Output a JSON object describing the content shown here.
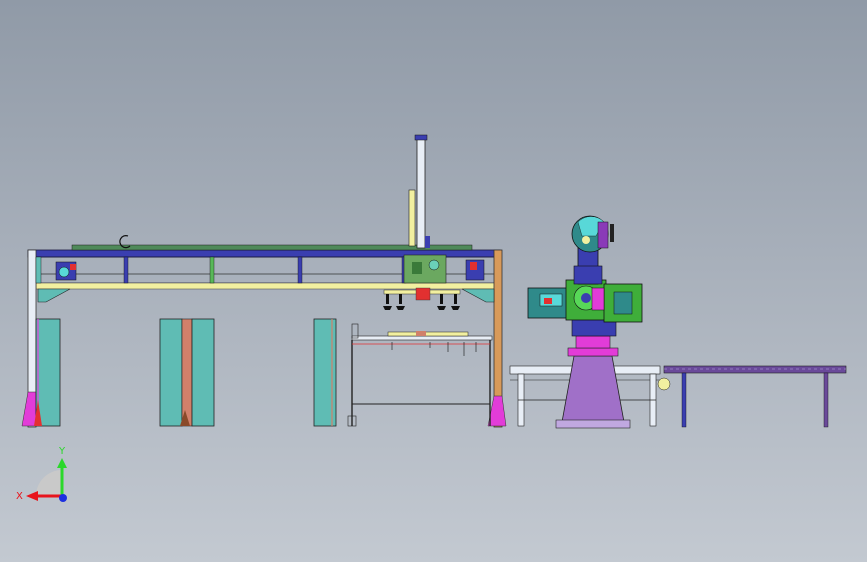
{
  "axes": {
    "x_label": "X",
    "y_label": "Y",
    "x_color": "#e8141c",
    "y_color": "#2bd82b",
    "z_color": "#1c2fe0"
  },
  "colors": {
    "background_top": "#909aa7",
    "background_bottom": "#c3c9d1",
    "frame_blue": "#3a3eb0",
    "beam_yellow": "#f2f0a0",
    "column_teal": "#5fbcb4",
    "robot_magenta": "#e23cd8",
    "pedestal_purple": "#a070c8",
    "conveyor_purple": "#6a4a9a",
    "robot_green": "#3fae3a",
    "head_teal": "#2f8a8a"
  }
}
